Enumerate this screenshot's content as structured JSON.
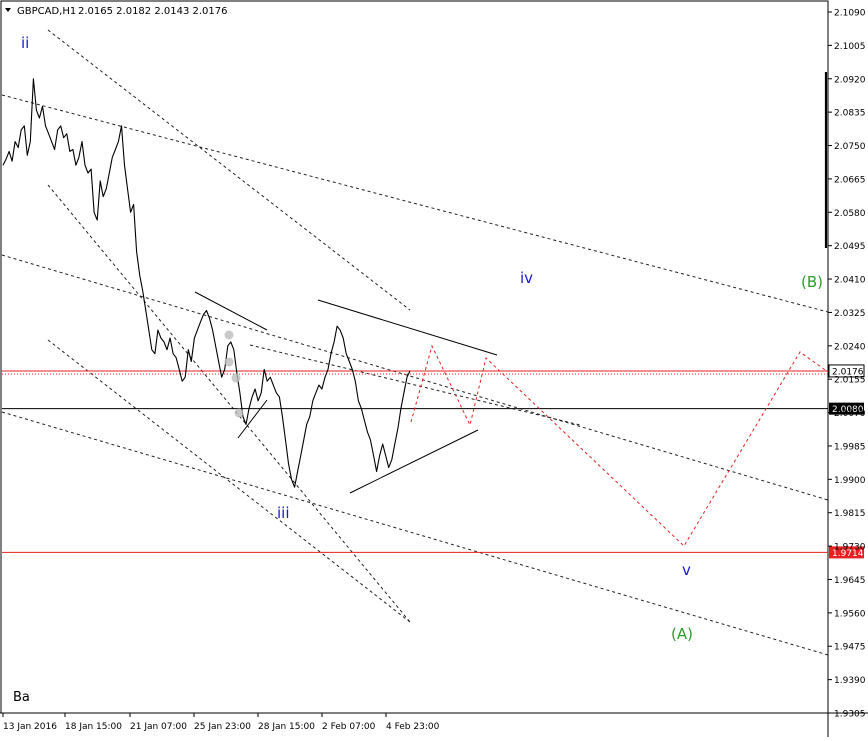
{
  "header": {
    "symbol_timeframe": "GBPCAD,H1",
    "ohlc": "2.0165 2.0182 2.0143 2.0176"
  },
  "watermark": "Ba",
  "colors": {
    "background": "#ffffff",
    "price_line": "#000000",
    "wave_blue": "#1a1acd",
    "wave_green": "#2e9c2e",
    "projection_red": "#e82020",
    "level_red": "#e82020"
  },
  "chart_data": {
    "type": "line",
    "title": "",
    "xlabel": "",
    "ylabel": "",
    "x_ticks": [
      "13 Jan 2016",
      "18 Jan 15:00",
      "21 Jan 07:00",
      "25 Jan 23:00",
      "28 Jan 15:00",
      "2 Feb 07:00",
      "4 Feb 23:00"
    ],
    "y_ticks": [
      1.9305,
      1.939,
      1.9475,
      1.956,
      1.9645,
      1.973,
      1.9815,
      1.99,
      1.9985,
      2.007,
      2.0155,
      2.024,
      2.0325,
      2.041,
      2.0495,
      2.058,
      2.0665,
      2.075,
      2.0835,
      2.092,
      2.1005,
      2.109
    ],
    "y_tick_labels": [
      "1.9305",
      "1.9390",
      "1.9475",
      "1.9560",
      "1.9645",
      "1.9730",
      "1.9815",
      "1.9900",
      "1.9985",
      "2.0070",
      "2.0155",
      "2.0240",
      "2.0325",
      "2.0410",
      "2.0495",
      "2.0580",
      "2.0665",
      "2.0750",
      "2.0835",
      "2.0920",
      "2.1005",
      "2.1090"
    ],
    "ylim": [
      1.93,
      2.1105
    ],
    "price_series_close": [
      2.07,
      2.0715,
      2.0735,
      2.071,
      2.076,
      2.0745,
      2.079,
      2.08,
      2.0725,
      2.076,
      2.092,
      2.084,
      2.082,
      2.085,
      2.08,
      2.078,
      2.076,
      2.074,
      2.079,
      2.08,
      2.077,
      2.078,
      2.0735,
      2.074,
      2.07,
      2.072,
      2.076,
      2.07,
      2.068,
      2.069,
      2.058,
      2.056,
      2.066,
      2.062,
      2.064,
      2.068,
      2.072,
      2.074,
      2.076,
      2.08,
      2.07,
      2.064,
      2.058,
      2.06,
      2.048,
      2.042,
      2.038,
      2.033,
      2.028,
      2.023,
      2.022,
      2.028,
      2.026,
      2.025,
      2.023,
      2.026,
      2.022,
      2.021,
      2.018,
      2.015,
      2.016,
      2.023,
      2.02,
      2.026,
      2.028,
      2.03,
      2.032,
      2.033,
      2.031,
      2.028,
      2.024,
      2.02,
      2.016,
      2.018,
      2.024,
      2.025,
      2.023,
      2.017,
      2.012,
      2.006,
      2.004,
      2.008,
      2.011,
      2.013,
      2.01,
      2.012,
      2.018,
      2.015,
      2.016,
      2.014,
      2.012,
      2.011,
      2.006,
      2.0,
      1.994,
      1.99,
      1.988,
      1.992,
      1.996,
      2.0,
      2.004,
      2.006,
      2.01,
      2.012,
      2.014,
      2.013,
      2.016,
      2.018,
      2.022,
      2.025,
      2.029,
      2.028,
      2.026,
      2.022,
      2.02,
      2.018,
      2.015,
      2.01,
      2.008,
      2.005,
      2.002,
      2.0,
      1.996,
      1.992,
      1.996,
      1.999,
      1.996,
      1.993,
      1.995,
      1.999,
      2.003,
      2.008,
      2.012,
      2.016,
      2.0176
    ],
    "horizontal_levels": [
      {
        "value": 2.0176,
        "label": "2.0176",
        "style": "red-dotted",
        "tag": "bid"
      },
      {
        "value": 2.008,
        "label": "2.0080",
        "style": "black-solid",
        "tag": "level"
      },
      {
        "value": 1.9714,
        "label": "1.9714",
        "style": "red-solid",
        "tag": "level"
      }
    ],
    "wave_labels": [
      {
        "text": "ii",
        "x": "14 Jan 2016 01:00",
        "y": 2.099,
        "color": "blue"
      },
      {
        "text": "iii",
        "x": "28 Jan 12:00",
        "y": 1.9835,
        "color": "blue"
      },
      {
        "text": "iv",
        "x": "6 Feb 15:00",
        "y": 2.0345,
        "color": "blue"
      },
      {
        "text": "v",
        "x": "11 Feb 08:00",
        "y": 1.9675,
        "color": "blue"
      },
      {
        "text": "(B)",
        "x": "16 Feb 20:00",
        "y": 2.039,
        "color": "green"
      },
      {
        "text": "(A)",
        "x": "11 Feb 08:00",
        "y": 1.95,
        "color": "green"
      }
    ],
    "grid": false,
    "legend": "none"
  }
}
